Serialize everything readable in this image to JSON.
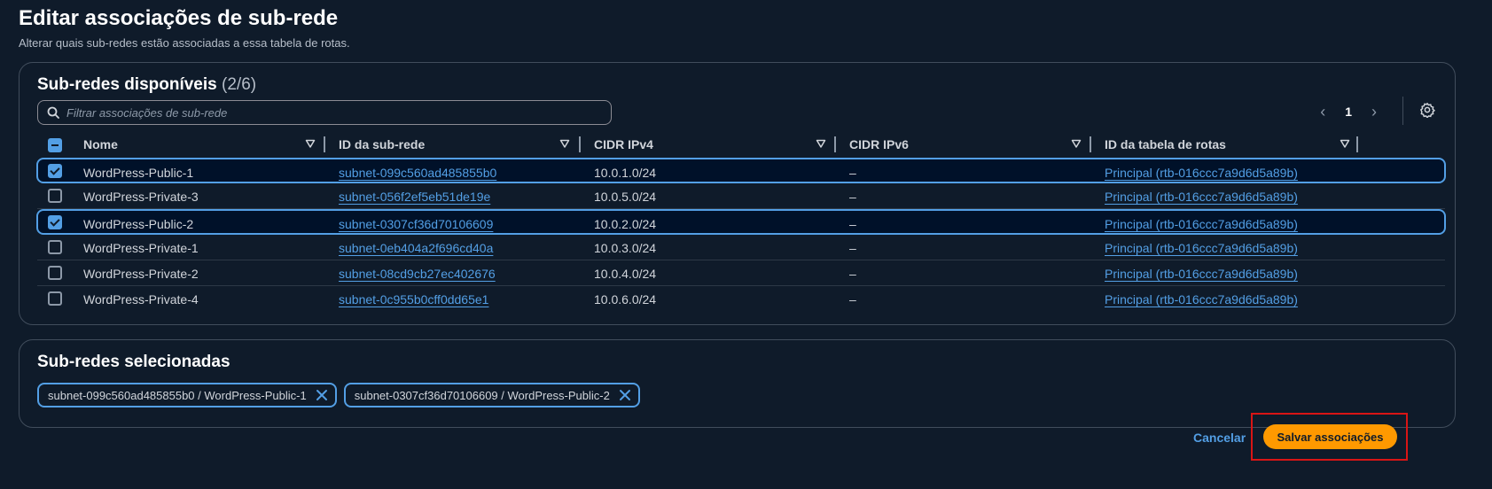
{
  "page": {
    "title": "Editar associações de sub-rede",
    "subtitle": "Alterar quais sub-redes estão associadas a essa tabela de rotas."
  },
  "available": {
    "title": "Sub-redes disponíveis",
    "count": "(2/6)",
    "filter_placeholder": "Filtrar associações de sub-rede",
    "page_number": "1",
    "columns": [
      "Nome",
      "ID da sub-rede",
      "CIDR IPv4",
      "CIDR IPv6",
      "ID da tabela de rotas"
    ],
    "rows": [
      {
        "selected": true,
        "name": "WordPress-Public-1",
        "subnet_id": "subnet-099c560ad485855b0",
        "cidr_ipv4": "10.0.1.0/24",
        "cidr_ipv6": "–",
        "route_table": "Principal (rtb-016ccc7a9d6d5a89b)"
      },
      {
        "selected": false,
        "name": "WordPress-Private-3",
        "subnet_id": "subnet-056f2ef5eb51de19e",
        "cidr_ipv4": "10.0.5.0/24",
        "cidr_ipv6": "–",
        "route_table": "Principal (rtb-016ccc7a9d6d5a89b)"
      },
      {
        "selected": true,
        "name": "WordPress-Public-2",
        "subnet_id": "subnet-0307cf36d70106609",
        "cidr_ipv4": "10.0.2.0/24",
        "cidr_ipv6": "–",
        "route_table": "Principal (rtb-016ccc7a9d6d5a89b)"
      },
      {
        "selected": false,
        "name": "WordPress-Private-1",
        "subnet_id": "subnet-0eb404a2f696cd40a",
        "cidr_ipv4": "10.0.3.0/24",
        "cidr_ipv6": "–",
        "route_table": "Principal (rtb-016ccc7a9d6d5a89b)"
      },
      {
        "selected": false,
        "name": "WordPress-Private-2",
        "subnet_id": "subnet-08cd9cb27ec402676",
        "cidr_ipv4": "10.0.4.0/24",
        "cidr_ipv6": "–",
        "route_table": "Principal (rtb-016ccc7a9d6d5a89b)"
      },
      {
        "selected": false,
        "name": "WordPress-Private-4",
        "subnet_id": "subnet-0c955b0cff0dd65e1",
        "cidr_ipv4": "10.0.6.0/24",
        "cidr_ipv6": "–",
        "route_table": "Principal (rtb-016ccc7a9d6d5a89b)"
      }
    ]
  },
  "selected_panel": {
    "title": "Sub-redes selecionadas",
    "tokens": [
      "subnet-099c560ad485855b0 / WordPress-Public-1",
      "subnet-0307cf36d70106609 / WordPress-Public-2"
    ]
  },
  "footer": {
    "cancel_label": "Cancelar",
    "save_label": "Salvar associações"
  },
  "colors": {
    "background": "#0f1b2a",
    "link": "#539fe5",
    "primary_button": "#ff9900",
    "highlight": "#d91515"
  },
  "icons": [
    "search-icon",
    "chevron-left-icon",
    "chevron-right-icon",
    "gear-icon",
    "sort-caret-icon",
    "close-icon"
  ]
}
